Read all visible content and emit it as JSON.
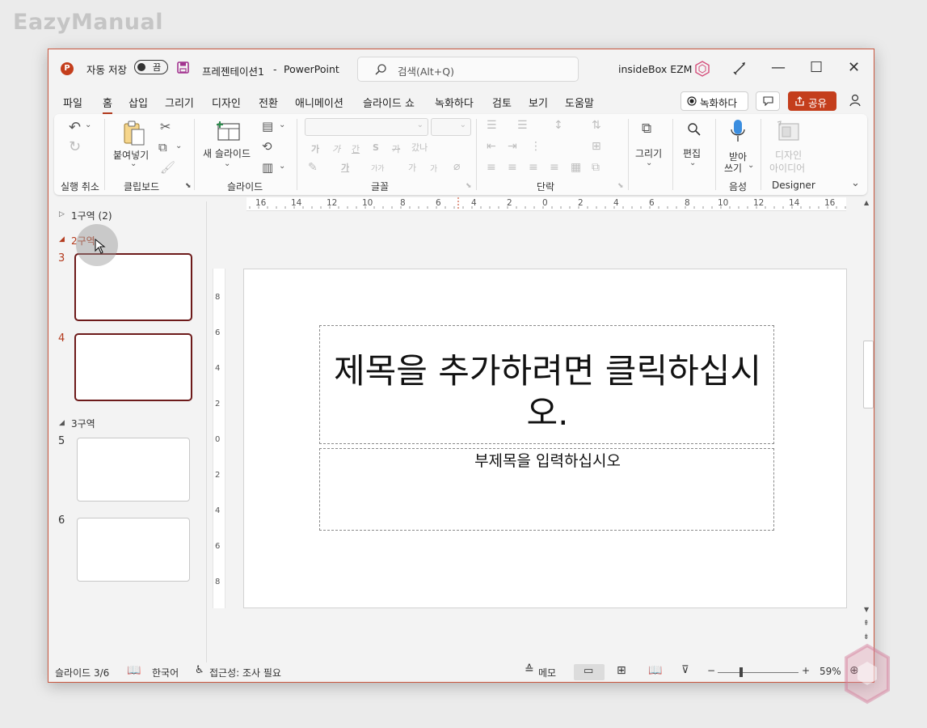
{
  "watermark": "EazyManual",
  "titlebar": {
    "app_letter": "P",
    "autosave_label": "자동 저장",
    "autosave_state": "끔",
    "document_title": "프레젠테이션1",
    "separator": "-",
    "app_name": "PowerPoint",
    "search_placeholder": "검색(Alt+Q)",
    "user_name": "insideBox EZM",
    "minimize": "—",
    "maximize": "☐",
    "close": "✕"
  },
  "menu": {
    "tabs": [
      "파일",
      "홈",
      "삽입",
      "그리기",
      "디자인",
      "전환",
      "애니메이션",
      "슬라이드 쇼",
      "녹화하다",
      "검토",
      "보기",
      "도움말"
    ],
    "active_tab": "홈",
    "record_button": "녹화하다",
    "share_button": "공유"
  },
  "ribbon": {
    "groups": {
      "undo": "실행 취소",
      "clipboard": "클립보드",
      "slides": "슬라이드",
      "font": "글꼴",
      "paragraph": "단락",
      "voice": "음성",
      "designer": "Designer"
    },
    "paste_label": "붙여넣기",
    "new_slide_label": "새 슬라이드",
    "draw_label": "그리기",
    "edit_label": "편집",
    "dictate_label_1": "받아",
    "dictate_label_2": "쓰기",
    "designer_label_1": "디자인",
    "designer_label_2": "아이디어",
    "font_glyphs": [
      "가",
      "가",
      "간",
      "S",
      "가",
      "갔나",
      "가",
      "가가",
      "가",
      "가"
    ]
  },
  "slide_panel": {
    "sections": [
      {
        "name": "1구역 (2)",
        "collapsed": true
      },
      {
        "name": "2구역",
        "collapsed": false,
        "slides": [
          "3",
          "4"
        ],
        "color": "#b33a1d"
      },
      {
        "name": "3구역",
        "collapsed": false,
        "slides": [
          "5",
          "6"
        ]
      }
    ]
  },
  "ruler": {
    "horizontal": [
      "16",
      "14",
      "12",
      "10",
      "8",
      "6",
      "4",
      "2",
      "0",
      "2",
      "4",
      "6",
      "8",
      "10",
      "12",
      "14",
      "16"
    ],
    "vertical": [
      "8",
      "6",
      "4",
      "2",
      "0",
      "2",
      "4",
      "6",
      "8"
    ]
  },
  "slide": {
    "title_placeholder": "제목을 추가하려면 클릭하십시오.",
    "subtitle_placeholder": "부제목을 입력하십시오"
  },
  "status": {
    "slide_counter": "슬라이드 3/6",
    "language": "한국어",
    "accessibility": "접근성: 조사 필요",
    "notes": "메모",
    "zoom_out": "−",
    "zoom_in": "+",
    "zoom_level": "59%"
  },
  "colors": {
    "accent": "#c43e1c",
    "section_accent": "#b33a1d",
    "selected_thumb_border": "#6d1a1a"
  }
}
